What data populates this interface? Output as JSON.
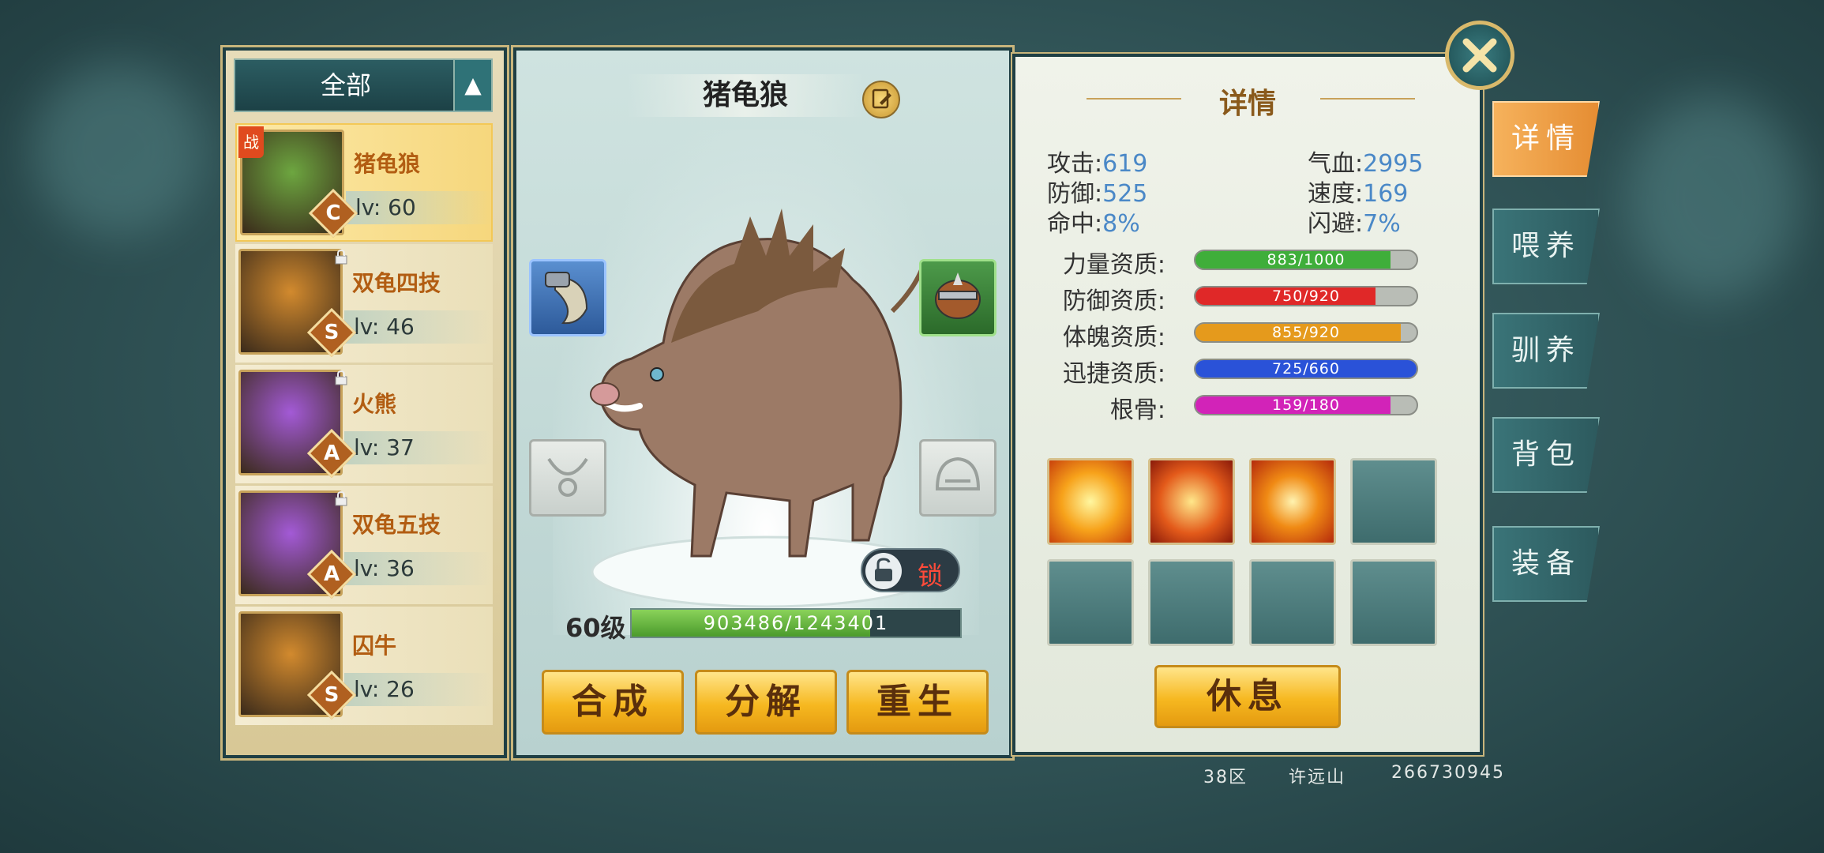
{
  "left_panel": {
    "filter_label": "全部",
    "toggle_icon": "chevron-up-icon",
    "pets": [
      {
        "name": "猪龟狼",
        "level": "lv: 60",
        "grade": "C",
        "battle_tag": "战",
        "selected": true,
        "locked": false,
        "frame_color": "#6da640"
      },
      {
        "name": "双龟四技",
        "level": "lv: 46",
        "grade": "S",
        "battle_tag": "",
        "selected": false,
        "locked": true,
        "frame_color": "#d28a2e"
      },
      {
        "name": "火熊",
        "level": "lv: 37",
        "grade": "A",
        "battle_tag": "",
        "selected": false,
        "locked": true,
        "frame_color": "#a35ad6"
      },
      {
        "name": "双龟五技",
        "level": "lv: 36",
        "grade": "A",
        "battle_tag": "",
        "selected": false,
        "locked": true,
        "frame_color": "#a35ad6"
      },
      {
        "name": "囚牛",
        "level": "lv: 26",
        "grade": "S",
        "battle_tag": "",
        "selected": false,
        "locked": false,
        "frame_color": "#d28a2e"
      }
    ]
  },
  "center_panel": {
    "pet_name": "猪龟狼",
    "level_label": "60级",
    "exp_text": "903486/1243401",
    "exp_fraction": 0.727,
    "lock_label": "锁",
    "buttons": {
      "compose": "合成",
      "decompose": "分解",
      "rebirth": "重生"
    }
  },
  "right_panel": {
    "title": "详情",
    "stats": {
      "attack_label": "攻击:",
      "attack_value": "619",
      "hp_label": "气血:",
      "hp_value": "2995",
      "defense_label": "防御:",
      "defense_value": "525",
      "speed_label": "速度:",
      "speed_value": "169",
      "hit_label": "命中:",
      "hit_value": "8%",
      "dodge_label": "闪避:",
      "dodge_value": "7%"
    },
    "aptitudes": [
      {
        "label": "力量资质:",
        "text": "883/1000",
        "fraction": 0.883,
        "color": "#3fae3a"
      },
      {
        "label": "防御资质:",
        "text": "750/920",
        "fraction": 0.815,
        "color": "#e02828"
      },
      {
        "label": "体魄资质:",
        "text": "855/920",
        "fraction": 0.929,
        "color": "#e59a1c"
      },
      {
        "label": "迅捷资质:",
        "text": "725/660",
        "fraction": 1.0,
        "color": "#2a52d8"
      },
      {
        "label": "根骨:",
        "text": "159/180",
        "fraction": 0.883,
        "color": "#d223b8"
      }
    ],
    "rest_label": "休息"
  },
  "tabs": {
    "details": "详情",
    "feed": "喂养",
    "train": "驯养",
    "bag": "背包",
    "equip": "装备"
  },
  "footer": {
    "server": "38区",
    "player": "许远山",
    "id": "266730945"
  }
}
